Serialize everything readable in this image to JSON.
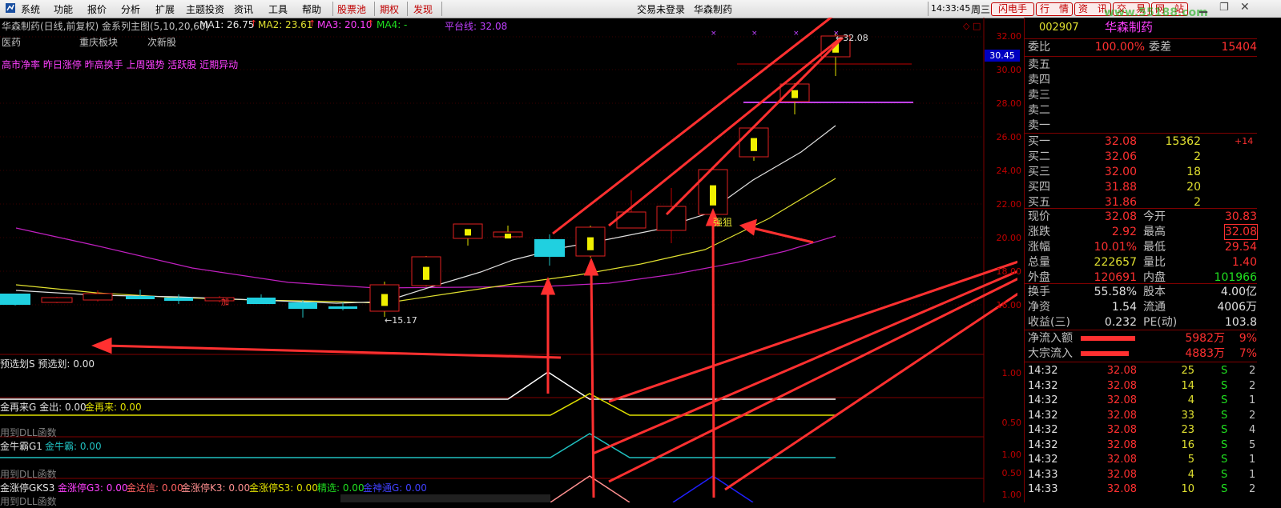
{
  "menubar": {
    "items": [
      "系统",
      "功能",
      "报价",
      "分析",
      "扩展",
      "主题投资",
      "资讯",
      "工具",
      "帮助"
    ],
    "red_items": [
      "股票池",
      "期权",
      "发现"
    ],
    "login": "交易未登录",
    "stock_name": "华森制药",
    "time": "14:33:45",
    "weekday": "周三",
    "buttons": [
      "闪电手",
      "行　情",
      "资　讯",
      "交　易",
      "网　站"
    ],
    "watermark": "www.55188.com"
  },
  "chart": {
    "title": "华森制药(日线,前复权) 金系列主图(5,10,20,60)",
    "ma1": "MA1: 26.75",
    "ma2": "MA2: 23.61",
    "ma3": "MA3: 20.10",
    "ma4": "MA4: -",
    "platform": "平台线: 32.08",
    "row2": [
      "医药",
      "重庆板块",
      "次新股"
    ],
    "tags": "高市净率 昨日涨停 昨高换手 上周强势 活跃股 近期异动",
    "price_label": "30.45",
    "high_label": "32.08",
    "low_label": "15.17",
    "strong_label": "强狙",
    "jia_label": "加",
    "y_axis": [
      "32.00",
      "30.00",
      "28.00",
      "26.00",
      "24.00",
      "22.00",
      "20.00",
      "18.00",
      "16.00"
    ]
  },
  "indicators": {
    "p1_title": "预选划S  预选划: 0.00",
    "p1_axis": [
      "1.00"
    ],
    "p2_title": "金再来G  金出: 0.00",
    "p2_val": "金再来: 0.00",
    "p2_dll": "用到DLL函数",
    "p2_axis": [
      "0.50"
    ],
    "p3_title": "金牛霸G1",
    "p3_val": "金牛霸: 0.00",
    "p3_dll": "用到DLL函数",
    "p3_axis": [
      "1.00",
      "0.50"
    ],
    "p4_title": "金涨停GKS3",
    "p4_g3": "金涨停G3: 0.00",
    "p4_jd": "金达信: 0.00",
    "p4_k3": "金涨停K3: 0.00",
    "p4_s3": "金涨停S3: 0.00",
    "p4_jx": "精选: 0.00",
    "p4_jz": "金神通G: 0.00",
    "p4_dll": "用到DLL函数",
    "p4_axis": [
      "1.00"
    ]
  },
  "panel": {
    "code": "002907",
    "name": "华森制药",
    "weibi_label": "委比",
    "weibi": "100.00%",
    "weicha_label": "委差",
    "weicha": "15404",
    "sells": [
      "卖五",
      "卖四",
      "卖三",
      "卖二",
      "卖一"
    ],
    "buys": [
      {
        "label": "买一",
        "price": "32.08",
        "vol": "15362",
        "chg": "+14"
      },
      {
        "label": "买二",
        "price": "32.06",
        "vol": "2",
        "chg": ""
      },
      {
        "label": "买三",
        "price": "32.00",
        "vol": "18",
        "chg": ""
      },
      {
        "label": "买四",
        "price": "31.88",
        "vol": "20",
        "chg": ""
      },
      {
        "label": "买五",
        "price": "31.86",
        "vol": "2",
        "chg": ""
      }
    ],
    "stats": [
      {
        "l1": "现价",
        "v1": "32.08",
        "l2": "今开",
        "v2": "30.83"
      },
      {
        "l1": "涨跌",
        "v1": "2.92",
        "l2": "最高",
        "v2": "32.08"
      },
      {
        "l1": "涨幅",
        "v1": "10.01%",
        "l2": "最低",
        "v2": "29.54"
      },
      {
        "l1": "总量",
        "v1": "222657",
        "l2": "量比",
        "v2": "1.40"
      },
      {
        "l1": "外盘",
        "v1": "120691",
        "l2": "内盘",
        "v2": "101966"
      }
    ],
    "stats2": [
      {
        "l1": "换手",
        "v1": "55.58%",
        "l2": "股本",
        "v2": "4.00亿"
      },
      {
        "l1": "净资",
        "v1": "1.54",
        "l2": "流通",
        "v2": "4006万"
      },
      {
        "l1": "收益(三)",
        "v1": "0.232",
        "l2": "PE(动)",
        "v2": "103.8"
      }
    ],
    "flows": [
      {
        "label": "净流入额",
        "val": "5982万",
        "pct": "9%"
      },
      {
        "label": "大宗流入",
        "val": "4883万",
        "pct": "7%"
      }
    ],
    "ticks": [
      {
        "t": "14:32",
        "p": "32.08",
        "v": "25",
        "s": "S",
        "n": "2"
      },
      {
        "t": "14:32",
        "p": "32.08",
        "v": "14",
        "s": "S",
        "n": "2"
      },
      {
        "t": "14:32",
        "p": "32.08",
        "v": "4",
        "s": "S",
        "n": "1"
      },
      {
        "t": "14:32",
        "p": "32.08",
        "v": "33",
        "s": "S",
        "n": "2"
      },
      {
        "t": "14:32",
        "p": "32.08",
        "v": "23",
        "s": "S",
        "n": "4"
      },
      {
        "t": "14:32",
        "p": "32.08",
        "v": "16",
        "s": "S",
        "n": "5"
      },
      {
        "t": "14:32",
        "p": "32.08",
        "v": "5",
        "s": "S",
        "n": "1"
      },
      {
        "t": "14:33",
        "p": "32.08",
        "v": "4",
        "s": "S",
        "n": "1"
      },
      {
        "t": "14:33",
        "p": "32.08",
        "v": "10",
        "s": "S",
        "n": "2"
      }
    ]
  }
}
